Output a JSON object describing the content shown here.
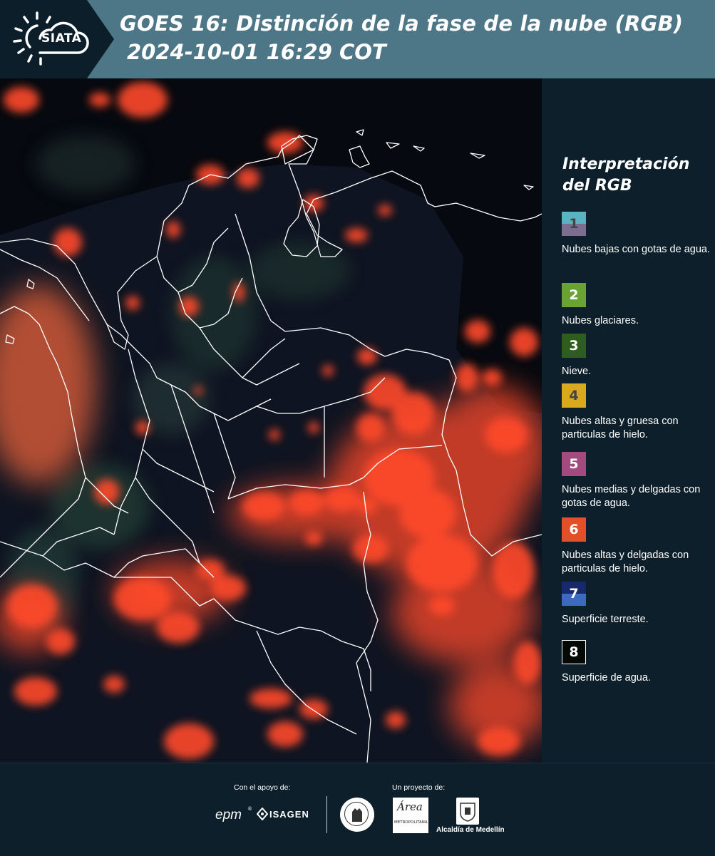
{
  "header": {
    "logo_text": "SIATA",
    "title": "GOES 16: Distinción de la fase de la nube (RGB)",
    "subtitle": "2024-10-01 16:29 COT",
    "bar_color": "#4d7686",
    "logo_bg": "#0c1e2a"
  },
  "legend": {
    "title": "Interpretación del RGB",
    "items": [
      {
        "num": "1",
        "label": "Nubes bajas con gotas de agua.",
        "color_top": "#5bb2c2",
        "color_bottom": "#7b6e8f",
        "num_color": "#444444"
      },
      {
        "num": "2",
        "label": "Nubes glaciares.",
        "color_top": "#6aa234",
        "color_bottom": "#6aa234",
        "num_color": "#ffffff"
      },
      {
        "num": "3",
        "label": "Nieve.",
        "color_top": "#2f5d1e",
        "color_bottom": "#2f5d1e",
        "num_color": "#ffffff"
      },
      {
        "num": "4",
        "label": "Nubes altas y gruesa con particulas de hielo.",
        "color_top": "#d9a91c",
        "color_bottom": "#d9a91c",
        "num_color": "#444444"
      },
      {
        "num": "5",
        "label": "Nubes medias y delgadas con gotas de agua.",
        "color_top": "#a34b7e",
        "color_bottom": "#a34b7e",
        "num_color": "#ffffff"
      },
      {
        "num": "6",
        "label": "Nubes altas y delgadas con particulas de hielo.",
        "color_top": "#e2502a",
        "color_bottom": "#e2502a",
        "num_color": "#ffffff"
      },
      {
        "num": "7",
        "label": "Superficie terreste.",
        "color_top": "#17296b",
        "color_bottom": "#3e69c0",
        "num_color": "#ffffff"
      },
      {
        "num": "8",
        "label": "Superficie de agua.",
        "color_top": "#050905",
        "color_bottom": "#050905",
        "num_color": "#ffffff"
      }
    ]
  },
  "footer": {
    "support_label": "Con el apoyo de:",
    "project_label": "Un proyecto de:",
    "epm": "epm",
    "isagen": "ISAGEN",
    "amva_text": "Área",
    "amva_sub": "METROPOLITANA",
    "alcaldia": "Alcaldía de Medellín"
  },
  "map": {
    "cloud_color": "#ff4a2c",
    "border_color": "#ffffff"
  }
}
